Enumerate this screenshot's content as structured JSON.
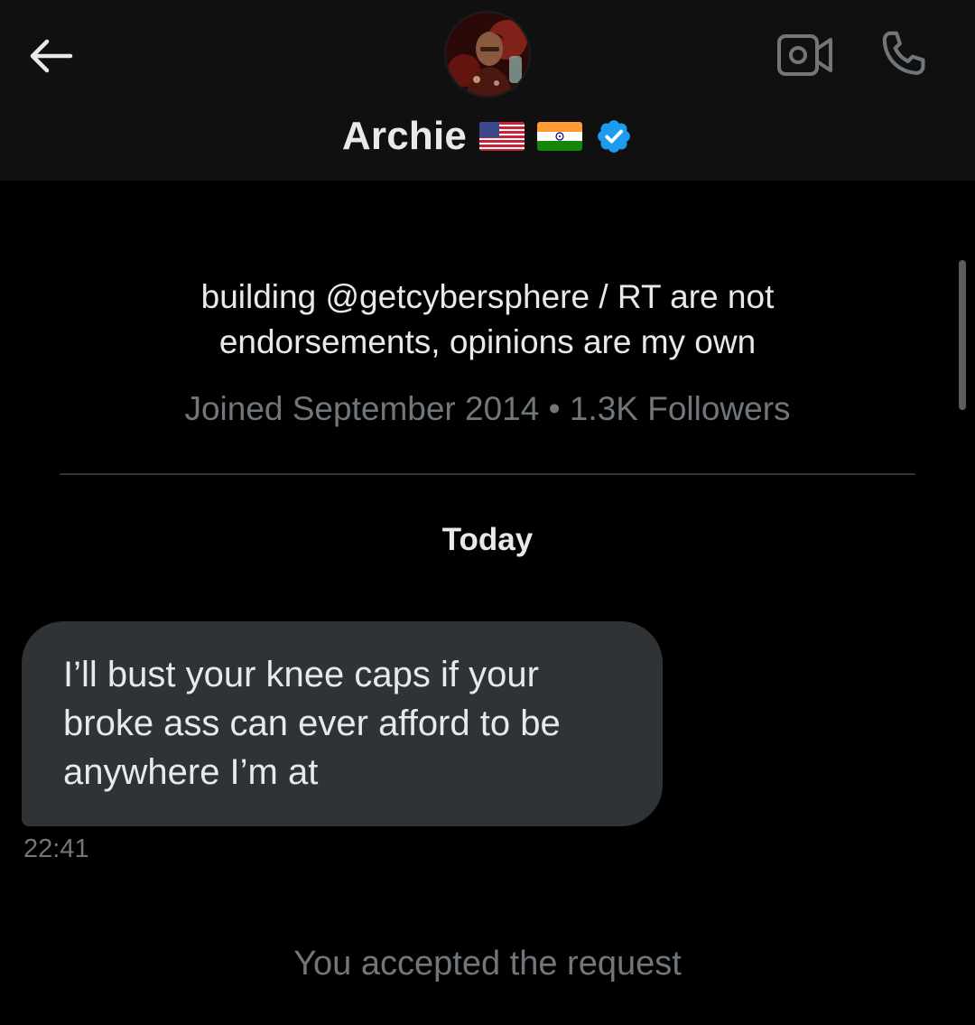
{
  "header": {
    "display_name": "Archie",
    "flags": [
      "us-flag-emoji",
      "india-flag-emoji"
    ],
    "verified": true,
    "verified_color": "#1d9bf0",
    "icons": {
      "back": "arrow-left-icon",
      "video": "video-camera-icon",
      "call": "phone-icon"
    }
  },
  "profile": {
    "bio": "building @getcybersphere / RT are not endorsements, opinions are my own",
    "meta": "Joined September 2014 • 1.3K Followers"
  },
  "conversation": {
    "day_label": "Today",
    "messages": [
      {
        "direction": "incoming",
        "text": "I’ll bust your knee caps if your broke ass can ever afford to be anywhere I’m at",
        "time": "22:41"
      }
    ],
    "system_message": "You accepted the request"
  },
  "colors": {
    "background": "#000000",
    "header_background": "#101010",
    "text_primary": "#e7e9ea",
    "text_secondary": "#71767b",
    "bubble_incoming": "#2f3336",
    "divider": "#2f3336"
  }
}
